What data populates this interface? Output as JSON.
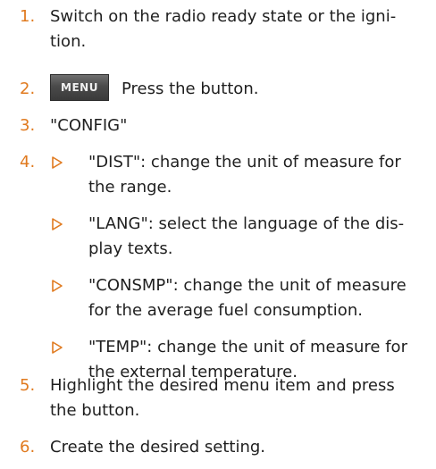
{
  "steps": [
    {
      "num": "1.",
      "line1": "Switch on the radio ready state or the igni-",
      "line2": "tion."
    },
    {
      "num": "2.",
      "button": "MENU",
      "text": "Press the button."
    },
    {
      "num": "3.",
      "text": "\"CONFIG\""
    },
    {
      "num": "4.",
      "items": [
        {
          "line1": "\"DIST\": change the unit of measure for",
          "line2": "the range."
        },
        {
          "line1": "\"LANG\": select the language of the dis-",
          "line2": "play texts."
        },
        {
          "line1": "\"CONSMP\": change the unit of measure",
          "line2": "for the average fuel consumption."
        },
        {
          "line1": "\"TEMP\": change the unit of measure for",
          "line2": "the external temperature."
        }
      ]
    },
    {
      "num": "5.",
      "line1": "Highlight the desired menu item and press",
      "line2": "the button."
    },
    {
      "num": "6.",
      "text": "Create the desired setting."
    }
  ],
  "colors": {
    "number": "#e07a1f",
    "text": "#1f1f1f",
    "arrow": "#e07a1f"
  },
  "icons": {
    "sub_bullet": "triangle-outline-right-icon"
  }
}
